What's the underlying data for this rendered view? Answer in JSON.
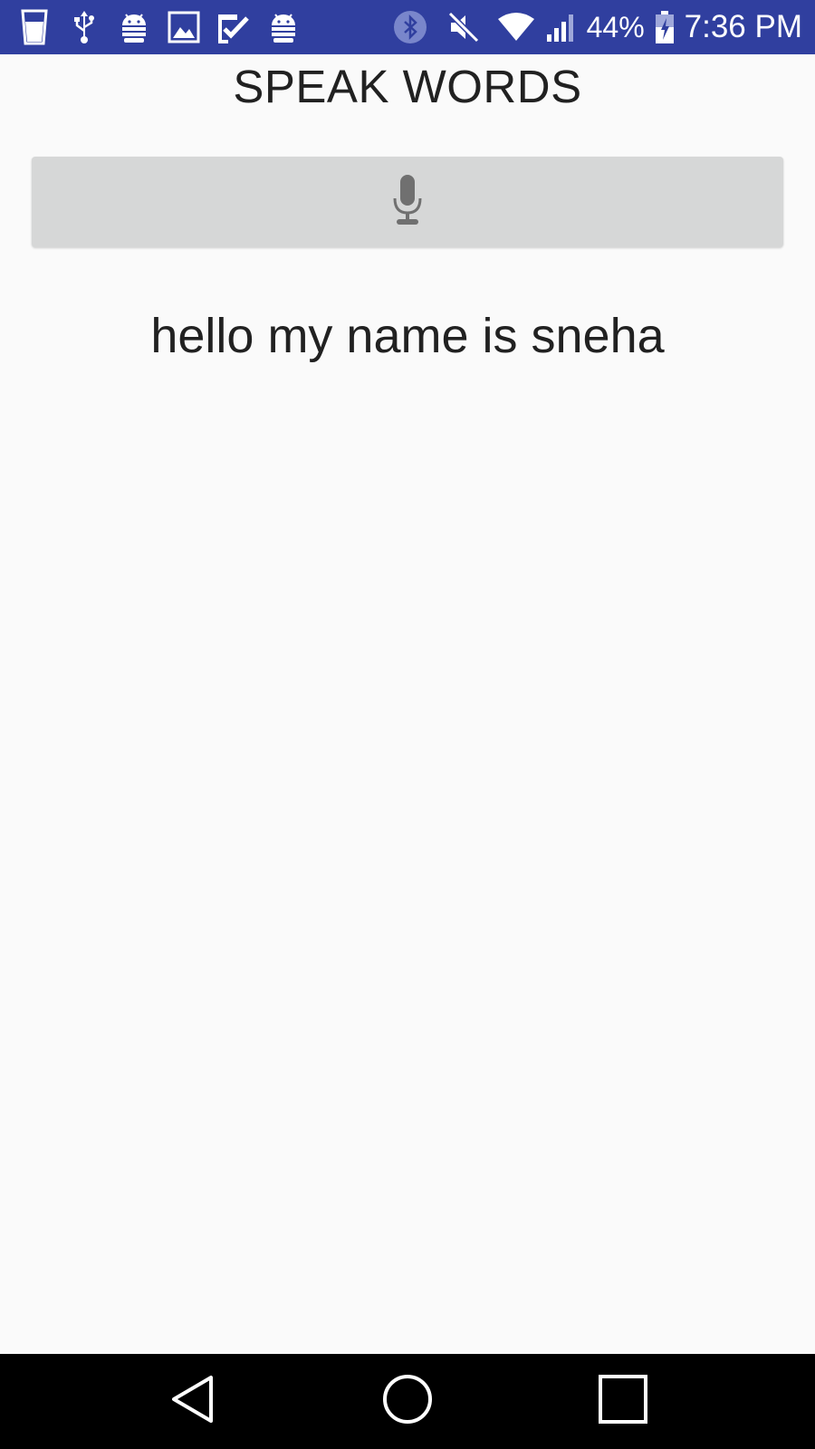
{
  "status_bar": {
    "color": "#303f9f",
    "left_icons": [
      "cup-icon",
      "usb-icon",
      "android-debug-icon",
      "image-icon",
      "checklist-icon",
      "android-icon"
    ],
    "right_icons": [
      "bluetooth-icon",
      "mute-icon",
      "wifi-icon",
      "cell-signal-icon",
      "battery-icon"
    ],
    "battery_percent": "44%",
    "time": "7:36 PM"
  },
  "app": {
    "title": "SPEAK WORDS",
    "mic_button_icon": "microphone-icon",
    "recognized_text": "hello my name is sneha"
  },
  "nav_bar": {
    "buttons": [
      "back-icon",
      "home-icon",
      "recents-icon"
    ]
  }
}
